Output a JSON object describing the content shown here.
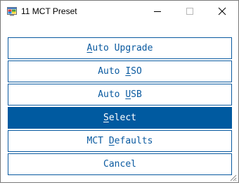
{
  "window": {
    "title": "11 MCT Preset"
  },
  "buttons": [
    {
      "label": "Auto Upgrade",
      "mnemonic_index": 0,
      "selected": false
    },
    {
      "label": "Auto ISO",
      "mnemonic_index": 5,
      "selected": false
    },
    {
      "label": "Auto USB",
      "mnemonic_index": 5,
      "selected": false
    },
    {
      "label": "Select",
      "mnemonic_index": 0,
      "selected": true
    },
    {
      "label": "MCT Defaults",
      "mnemonic_index": 4,
      "selected": false
    },
    {
      "label": "Cancel",
      "mnemonic_index": -1,
      "selected": false
    }
  ],
  "colors": {
    "accent": "#005aa0",
    "button_border": "#0a5aa0",
    "button_text": "#0a5aa0",
    "selected_text": "#ffffff"
  },
  "icons": {
    "app": "mct-app-icon",
    "minimize": "minimize-icon",
    "maximize": "maximize-icon",
    "close": "close-icon",
    "resize": "resize-grip-icon"
  }
}
